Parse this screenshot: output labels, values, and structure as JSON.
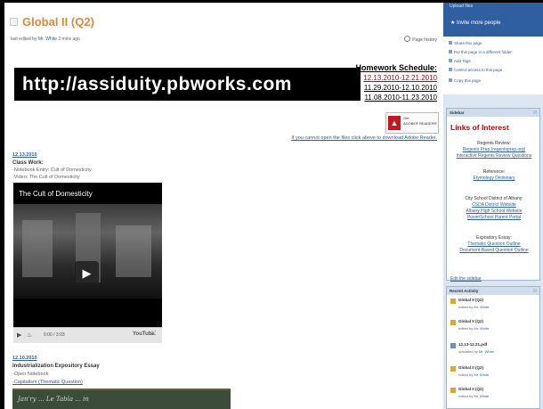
{
  "page": {
    "title": "Global II (Q2)",
    "edited_prefix": "last edited by",
    "edited_by": "Mr. White",
    "edited_when": "3 mins ago",
    "page_history": "Page history"
  },
  "banner": {
    "url": "http://assiduity.pbworks.com"
  },
  "homework": {
    "heading": "Homework Schedule:",
    "ranges": [
      "12.13.2010-12.21.2010",
      "11.29.2010-12.10.2010",
      "11.08.2010-11.23.2010"
    ]
  },
  "adobe": {
    "badge_line1": "Get",
    "badge_line2": "ADOBE® READER®",
    "help_link": "If you cannot open the files click above to download Adobe Reader."
  },
  "entries": [
    {
      "date": "12.13.2010",
      "heading": "Class Work:",
      "lines": [
        "-Notebook Entry: Cult of Domesticity",
        "-Video: The Cult of Domesticity"
      ],
      "video": {
        "title": "The Cult of Domesticity",
        "time": "0:00 / 3:03",
        "brand": "YouTube"
      }
    },
    {
      "date": "12.10.2010",
      "heading": "Industrialization Expository Essay",
      "lines": [
        "-Open Notebook",
        "-Capitalism (Thematic Question)"
      ],
      "board_text": "Jan'ry ... Le Tabla ... in"
    }
  ],
  "sidebar_top": {
    "upload": "Upload files",
    "invite": "Invite more people",
    "actions": [
      "Share this page",
      "Put this page in a different folder",
      "Add Tags",
      "Control access to this page",
      "Copy this page"
    ]
  },
  "sidebar": {
    "header": "Sidebar",
    "title": "Links of Interest",
    "groups": [
      {
        "heading": "Regents Review:",
        "links": [
          "Regents Prep (regentsprep.org)",
          "Interactive Regents Review Questions"
        ]
      },
      {
        "heading": "Reference:",
        "links": [
          "Etymology Dictionary"
        ]
      },
      {
        "heading": "City School District of Albany:",
        "links": [
          "CSDA District Website",
          "Albany High School Website",
          "PowerSchool Parent Portal"
        ]
      },
      {
        "heading": "Expository Essay:",
        "links": [
          "Thematic Question Outline",
          "Document-Based Question Outline"
        ]
      }
    ],
    "edit_link": "Edit the sidebar"
  },
  "recent": {
    "header": "Recent Activity",
    "items": [
      {
        "title": "Global II (Q2)",
        "action": "edited by",
        "who": "Mr. White"
      },
      {
        "title": "Global II (Q2)",
        "action": "edited by",
        "who": "Mr. White"
      },
      {
        "title": "12.13-12.21.pdf",
        "action": "uploaded by",
        "who": "Mr. White"
      },
      {
        "title": "Global II (Q2)",
        "action": "edited by",
        "who": "Mr. White"
      },
      {
        "title": "Global II (Q2)",
        "action": "edited by",
        "who": "Mr. White"
      }
    ]
  },
  "colors": {
    "title_orange": "#e0893a",
    "link_blue": "#2b5ea8",
    "alert_red": "#cc0000",
    "banner_black": "#000000"
  }
}
